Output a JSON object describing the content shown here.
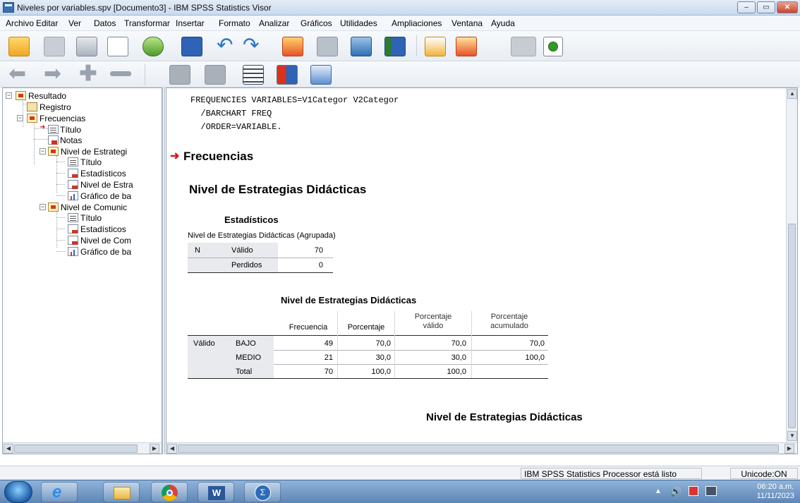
{
  "window": {
    "title": "Niveles por variables.spv [Documento3] - IBM SPSS Statistics Visor",
    "buttons": {
      "minimize": "–",
      "maximize": "▭",
      "close": "✕"
    }
  },
  "menu": [
    "Archivo",
    "Editar",
    "Ver",
    "Datos",
    "Transformar",
    "Insertar",
    "Formato",
    "Analizar",
    "Gráficos",
    "Utilidades",
    "Ampliaciones",
    "Ventana",
    "Ayuda"
  ],
  "toolbar1_icons": [
    "open-icon",
    "save-icon",
    "print-icon",
    "print-preview-icon",
    "export-icon",
    "recall-dialog-icon",
    "undo-icon",
    "redo-icon",
    "goto-case-icon",
    "goto-variable-icon",
    "insert-cases-icon",
    "split-file-icon",
    "designate-window-icon",
    "run-icon",
    "unused-disabled-icon",
    "add-icon"
  ],
  "toolbar2_icons": [
    "promote-icon",
    "demote-icon",
    "expand-icon",
    "collapse-icon",
    "show-icon",
    "hide-icon",
    "insert-heading-icon",
    "insert-title-icon",
    "insert-text-icon"
  ],
  "tree": {
    "root": "Resultado",
    "registro": "Registro",
    "frecuencias": "Frecuencias",
    "titulo": "Título",
    "notas": "Notas",
    "nivel_est": "Nivel de Estrategi",
    "titulo2": "Título",
    "estadisticos": "Estadísticos",
    "nivel_estra": "Nivel de Estra",
    "grafico1": "Gráfico de ba",
    "nivel_com": "Nivel de Comunic",
    "titulo3": "Título",
    "estadisticos2": "Estadísticos",
    "nivel_com2": "Nivel de Com",
    "grafico2": "Gráfico de ba"
  },
  "syntax": [
    "FREQUENCIES VARIABLES=V1Categor V2Categor",
    "  /BARCHART FREQ",
    "  /ORDER=VARIABLE."
  ],
  "output": {
    "heading": "Frecuencias",
    "subheading": "Nivel de Estrategias Didácticas",
    "stats": {
      "title": "Estadísticos",
      "caption": "Nivel de Estrategias Didácticas  (Agrupada)",
      "n_label": "N",
      "valid_label": "Válido",
      "valid_value": "70",
      "missing_label": "Perdidos",
      "missing_value": "0"
    },
    "freq": {
      "title": "Nivel de Estrategias Didácticas",
      "headers": [
        "Frecuencia",
        "Porcentaje",
        "Porcentaje\nválido",
        "Porcentaje\nacumulado"
      ],
      "group_label": "Válido",
      "rows": [
        {
          "label": "BAJO",
          "values": [
            "49",
            "70,0",
            "70,0",
            "70,0"
          ]
        },
        {
          "label": "MEDIO",
          "values": [
            "21",
            "30,0",
            "30,0",
            "100,0"
          ]
        },
        {
          "label": "Total",
          "values": [
            "70",
            "100,0",
            "100,0",
            ""
          ]
        }
      ]
    },
    "chart_title": "Nivel de Estrategias Didácticas"
  },
  "status": {
    "processor": "IBM SPSS Statistics Processor está listo",
    "unicode": "Unicode:ON"
  },
  "taskbar": {
    "apps": [
      "start-button",
      "internet-explorer-icon",
      "file-explorer-icon",
      "chrome-icon",
      "word-icon",
      "spss-icon"
    ],
    "time": "06:20 a.m.",
    "date": "11/11/2023"
  }
}
